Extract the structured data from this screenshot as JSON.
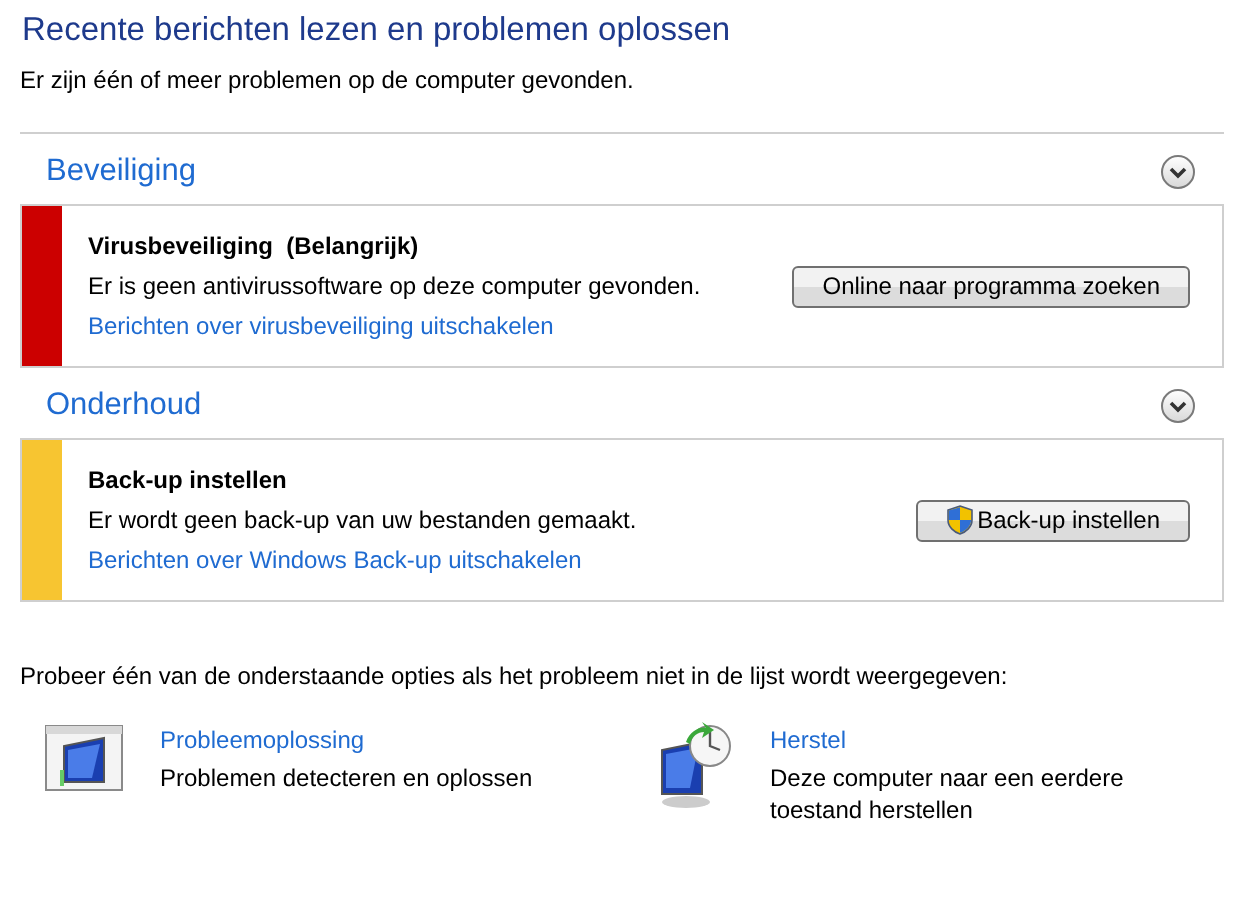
{
  "title": "Recente berichten lezen en problemen oplossen",
  "subtitle": "Er zijn één of meer problemen op de computer gevonden.",
  "sections": [
    {
      "heading": "Beveiliging",
      "items": [
        {
          "color": "#cc0000",
          "title": "Virusbeveiliging  (Belangrijk)",
          "description": "Er is geen antivirussoftware op deze computer gevonden.",
          "link": "Berichten over virusbeveiliging uitschakelen",
          "button": {
            "label": "Online naar programma zoeken",
            "shield": false
          }
        }
      ]
    },
    {
      "heading": "Onderhoud",
      "items": [
        {
          "color": "#f7c531",
          "title": "Back-up instellen",
          "description": "Er wordt geen back-up van uw bestanden gemaakt.",
          "link": "Berichten over Windows Back-up uitschakelen",
          "button": {
            "label": "Back-up instellen",
            "shield": true
          }
        }
      ]
    }
  ],
  "prompt": "Probeer één van de onderstaande opties als het probleem niet in de lijst wordt weergegeven:",
  "options": [
    {
      "kind": "troubleshoot",
      "title": "Probleemoplossing",
      "description": "Problemen detecteren en oplossen"
    },
    {
      "kind": "restore",
      "title": "Herstel",
      "description": "Deze computer naar een eerdere toestand herstellen"
    }
  ]
}
